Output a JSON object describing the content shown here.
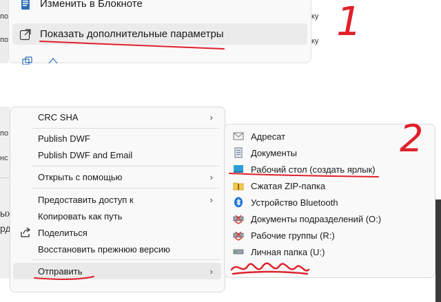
{
  "top_menu": {
    "items": [
      {
        "label": "Изменить в Блокноте",
        "icon": "notepad-icon"
      },
      {
        "label": "Показать дополнительные параметры",
        "icon": "external-options-icon"
      }
    ]
  },
  "background_fragments": {
    "left": [
      "по",
      "по",
      "по",
      "нс",
      "ых",
      "рд"
    ],
    "right": [
      "ку",
      "ку"
    ]
  },
  "classic_menu": {
    "items": [
      {
        "label": "CRC SHA",
        "submenu": true
      },
      {
        "label": "Publish DWF",
        "submenu": false
      },
      {
        "label": "Publish DWF and Email",
        "submenu": false
      },
      {
        "label": "Открыть с помощью",
        "submenu": true
      },
      {
        "label": "Предоставить доступ к",
        "submenu": true
      },
      {
        "label": "Копировать как путь",
        "submenu": false
      },
      {
        "label": "Поделиться",
        "submenu": false,
        "icon": "share-icon"
      },
      {
        "label": "Восстановить прежнюю версию",
        "submenu": false
      },
      {
        "label": "Отправить",
        "submenu": true
      }
    ],
    "arrow": "›"
  },
  "send_to_menu": {
    "items": [
      {
        "label": "Адресат",
        "icon": "mail-recipient-icon"
      },
      {
        "label": "Документы",
        "icon": "documents-icon"
      },
      {
        "label": "Рабочий стол (создать ярлык)",
        "icon": "desktop-icon"
      },
      {
        "label": "Сжатая ZIP-папка",
        "icon": "zip-folder-icon"
      },
      {
        "label": "Устройство Bluetooth",
        "icon": "bluetooth-icon"
      },
      {
        "label": "Документы подразделений (O:)",
        "icon": "network-drive-icon"
      },
      {
        "label": "Рабочие группы (R:)",
        "icon": "network-drive-icon"
      },
      {
        "label": "Личная папка (U:)",
        "icon": "drive-icon"
      }
    ]
  },
  "annotations": {
    "number_1": "1",
    "number_2": "2",
    "pen_color": "#e0202a"
  }
}
